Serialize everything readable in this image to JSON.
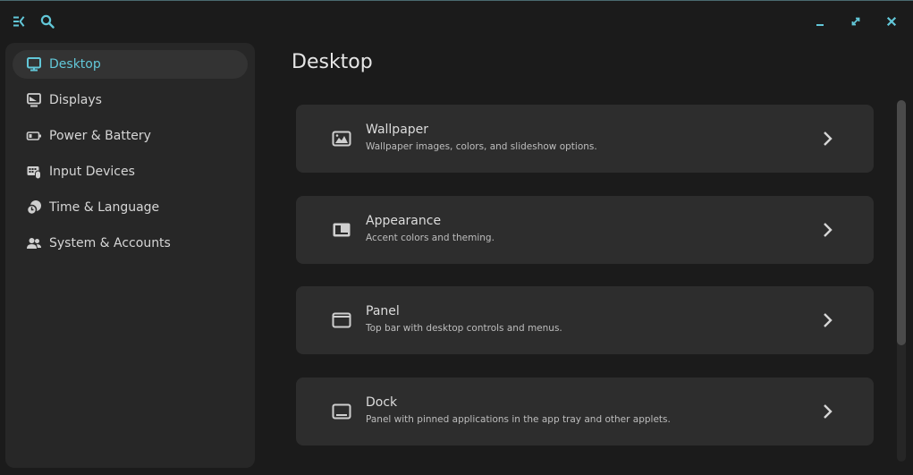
{
  "header": {
    "sidebar_toggle_icon": "sidebar-collapse-icon",
    "search_icon": "search-icon",
    "window_controls": [
      "minimize-icon",
      "maximize-icon",
      "close-icon"
    ]
  },
  "accent_color": "#62c7d8",
  "sidebar": {
    "items": [
      {
        "label": "Desktop",
        "icon": "monitor-icon",
        "active": true
      },
      {
        "label": "Displays",
        "icon": "display-icon",
        "active": false
      },
      {
        "label": "Power & Battery",
        "icon": "battery-icon",
        "active": false
      },
      {
        "label": "Input Devices",
        "icon": "keyboard-mouse-icon",
        "active": false
      },
      {
        "label": "Time & Language",
        "icon": "globe-clock-icon",
        "active": false
      },
      {
        "label": "System & Accounts",
        "icon": "users-icon",
        "active": false
      }
    ]
  },
  "main": {
    "title": "Desktop",
    "cards": [
      {
        "title": "Wallpaper",
        "description": "Wallpaper images, colors, and slideshow options.",
        "icon": "image-icon"
      },
      {
        "title": "Appearance",
        "description": "Accent colors and theming.",
        "icon": "appearance-icon"
      },
      {
        "title": "Panel",
        "description": "Top bar with desktop controls and menus.",
        "icon": "panel-icon"
      },
      {
        "title": "Dock",
        "description": "Panel with pinned applications in the app tray and other applets.",
        "icon": "dock-icon"
      }
    ]
  }
}
